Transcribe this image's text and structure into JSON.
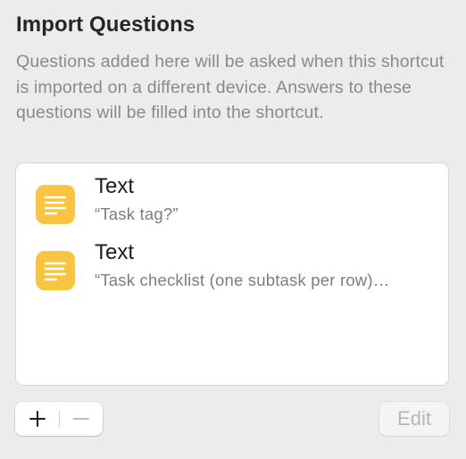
{
  "panel": {
    "title": "Import Questions",
    "description": "Questions added here will be asked when this shortcut is imported on a different device. Answers to these questions will be filled into the shortcut."
  },
  "questions": [
    {
      "type": "Text",
      "prompt": "“Task tag?”",
      "icon": "text-lines-icon"
    },
    {
      "type": "Text",
      "prompt": "“Task checklist (one subtask per row)…",
      "icon": "text-lines-icon"
    }
  ],
  "controls": {
    "add_icon": "plus-icon",
    "remove_icon": "minus-icon",
    "edit_label": "Edit"
  },
  "colors": {
    "window_background": "#ececec",
    "list_background": "#ffffff",
    "text_icon_background": "#f9c540",
    "secondary_text": "#8a8a8a",
    "disabled_text": "#b6b6b6"
  }
}
